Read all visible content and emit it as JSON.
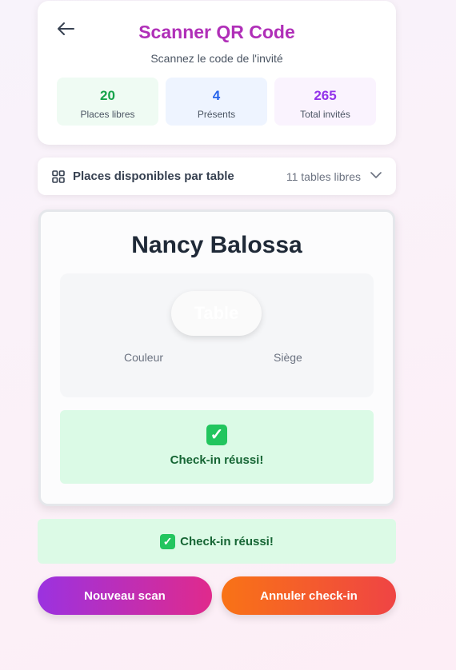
{
  "header": {
    "title": "Scanner QR Code",
    "subtitle": "Scannez le code de l'invité",
    "back_icon": "arrow-left-icon"
  },
  "stats": [
    {
      "value": "20",
      "label": "Places libres",
      "color": "#16a34a"
    },
    {
      "value": "4",
      "label": "Présents",
      "color": "#2563eb"
    },
    {
      "value": "265",
      "label": "Total invités",
      "color": "#9333ea"
    }
  ],
  "tables_bar": {
    "label": "Places disponibles par table",
    "count": "11 tables libres",
    "icon": "grid-icon"
  },
  "guest": {
    "name": "Nancy Balossa",
    "table_label": "Table",
    "color_label": "Couleur",
    "seat_label": "Siège",
    "success_icon": "✓",
    "success_message": "Check-in réussi!"
  },
  "banner": {
    "icon": "✓",
    "message": "Check-in réussi!"
  },
  "actions": {
    "new_scan": "Nouveau scan",
    "cancel_checkin": "Annuler check-in"
  },
  "colors": {
    "title": "#b02fb8",
    "success_bg": "#dcfae6",
    "success_text": "#166534"
  }
}
